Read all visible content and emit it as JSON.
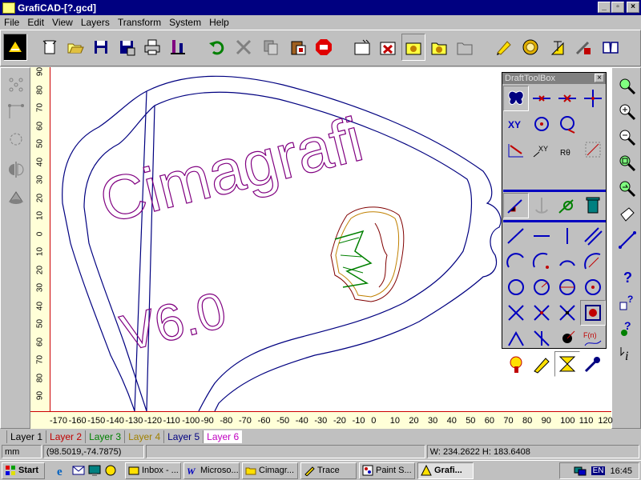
{
  "window": {
    "title": "GrafiCAD-[?.gcd]",
    "minimize": "_",
    "maximize": "▫",
    "close": "×"
  },
  "menu": [
    "File",
    "Edit",
    "View",
    "Layers",
    "Transform",
    "System",
    "Help"
  ],
  "toolbar": {
    "icons": [
      "logo-icon",
      "new-icon",
      "open-icon",
      "save-icon",
      "save-as-icon",
      "print-icon",
      "plot-icon",
      "undo-icon",
      "delete-icon",
      "copy-icon",
      "paste-icon",
      "stop-icon",
      "new-drawing-icon",
      "close-drawing-icon",
      "layer-icon",
      "layer-open-icon",
      "layer-folder-icon",
      "pencil-icon",
      "medal-icon",
      "stress-icon",
      "tools-icon",
      "book-icon"
    ]
  },
  "vruler": {
    "ticks": [
      "90",
      "80",
      "70",
      "60",
      "50",
      "40",
      "30",
      "20",
      "10",
      "0",
      "10",
      "20",
      "30",
      "40",
      "50",
      "60",
      "70",
      "80",
      "90"
    ]
  },
  "hruler": {
    "ticks": [
      "-170",
      "-160",
      "-150",
      "-140",
      "-130",
      "-120",
      "-110",
      "-100",
      "-90",
      "-80",
      "-70",
      "-60",
      "-50",
      "-40",
      "-30",
      "-20",
      "-10",
      "0",
      "10",
      "20",
      "30",
      "40",
      "50",
      "60",
      "70",
      "80",
      "90",
      "100",
      "110",
      "120"
    ]
  },
  "drawing": {
    "text1": "Cimagrafi",
    "text2": "V6.0"
  },
  "toolbox": {
    "title": "DraftToolBox",
    "close": "×",
    "row2_label": "XY",
    "row3_labels": [
      "XY",
      "Rθ"
    ],
    "fn_label": "F(n)"
  },
  "layers": [
    {
      "label": "Layer 1",
      "color": "#000000"
    },
    {
      "label": "Layer 2",
      "color": "#c00000"
    },
    {
      "label": "Layer 3",
      "color": "#008000"
    },
    {
      "label": "Layer 4",
      "color": "#a08000"
    },
    {
      "label": "Layer 5",
      "color": "#000080"
    },
    {
      "label": "Layer 6",
      "color": "#c000c0"
    }
  ],
  "status": {
    "units": "mm",
    "coords": "(98.5019,-74.7875)",
    "size": "W: 234.2622 H: 183.6408"
  },
  "taskbar": {
    "start": "Start",
    "tasks": [
      "Inbox - ...",
      "Microso...",
      "Cimagr...",
      "Trace",
      "Paint S...",
      "Grafi..."
    ],
    "lang": "EN",
    "time": "16:45"
  },
  "colors": {
    "titlebar": "#000080",
    "outline": "#000080",
    "text": "#800080"
  }
}
